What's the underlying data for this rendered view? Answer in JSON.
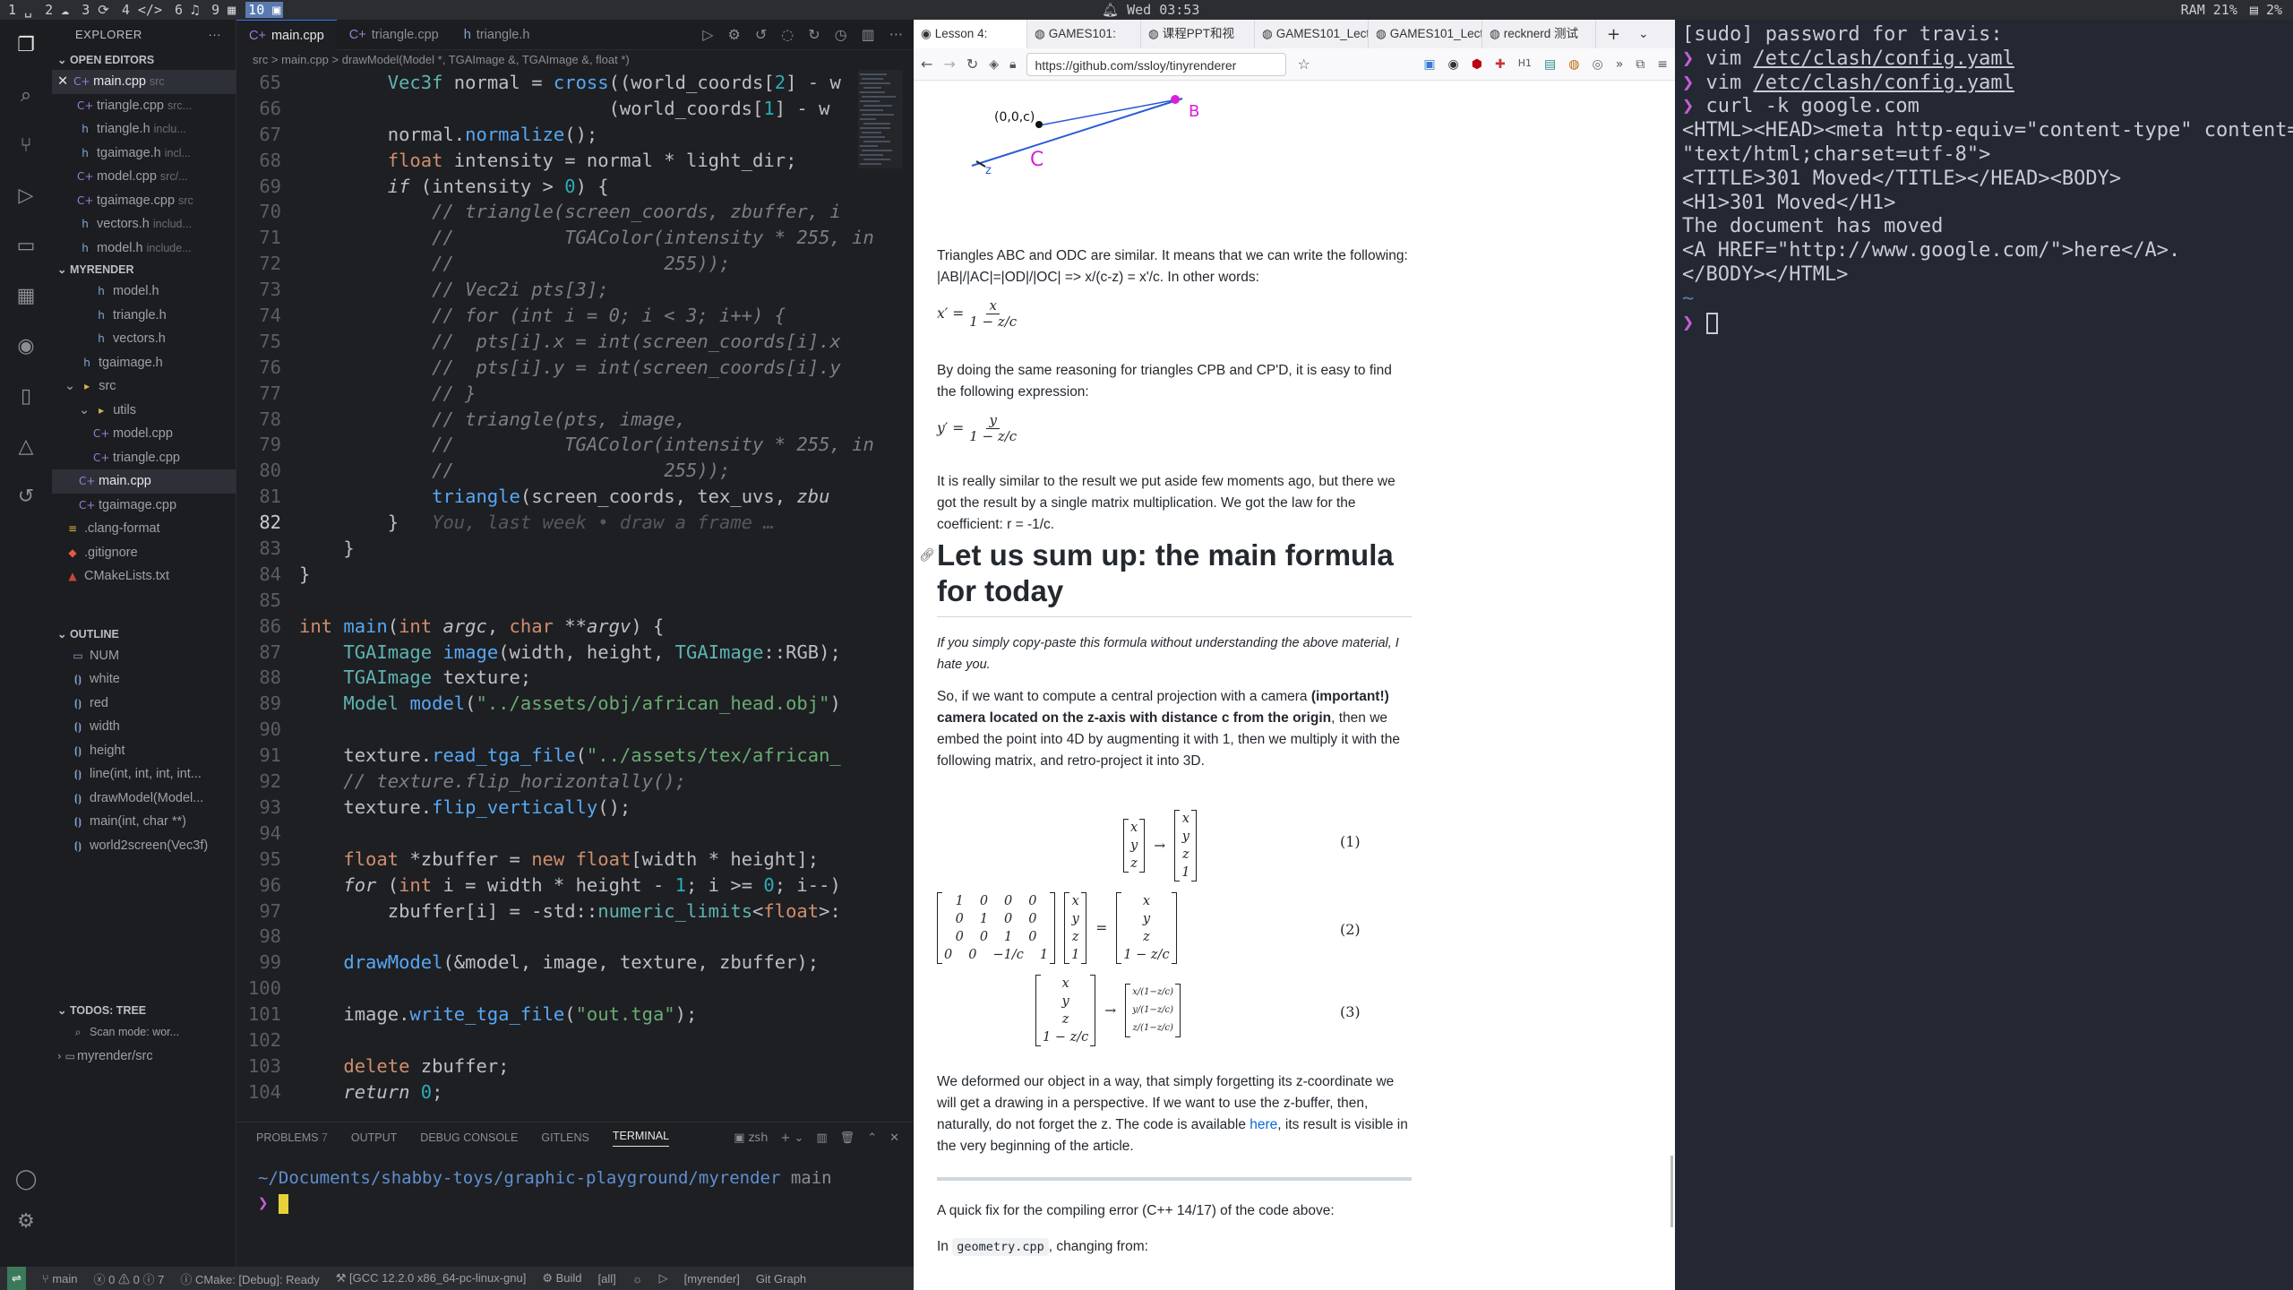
{
  "topbar": {
    "workspaces": [
      "1 ␣",
      "2 ☁",
      "3 ⟳",
      "4 </>",
      "6 ♫",
      "9 ▦",
      "10 ▣"
    ],
    "clock": "Wed 03:53",
    "ram": "RAM 21%",
    "cpu": "2%"
  },
  "vscode": {
    "explorer_title": "EXPLORER",
    "open_editors_title": "OPEN EDITORS",
    "open_editors": [
      {
        "name": "main.cpp",
        "hint": "src",
        "icon": "cpp-icon",
        "selected": true,
        "close": "✕"
      },
      {
        "name": "triangle.cpp",
        "hint": "src...",
        "icon": "cpp-icon"
      },
      {
        "name": "triangle.h",
        "hint": "inclu...",
        "icon": "h-icon"
      },
      {
        "name": "tgaimage.h",
        "hint": "incl...",
        "icon": "h-icon"
      },
      {
        "name": "model.cpp",
        "hint": "src/...",
        "icon": "cpp-icon"
      },
      {
        "name": "tgaimage.cpp",
        "hint": "src",
        "icon": "cpp-icon"
      },
      {
        "name": "vectors.h",
        "hint": "includ...",
        "icon": "h-icon"
      },
      {
        "name": "model.h",
        "hint": "include...",
        "icon": "h-icon"
      }
    ],
    "project_title": "MYRENDER",
    "tree": [
      {
        "name": "model.h",
        "indent": 2,
        "icon": "h-icon"
      },
      {
        "name": "triangle.h",
        "indent": 2,
        "icon": "h-icon"
      },
      {
        "name": "vectors.h",
        "indent": 2,
        "icon": "h-icon"
      },
      {
        "name": "tgaimage.h",
        "indent": 1,
        "icon": "h-icon"
      },
      {
        "name": "src",
        "indent": 0,
        "icon": "folder-icon"
      },
      {
        "name": "utils",
        "indent": 1,
        "icon": "folder-icon"
      },
      {
        "name": "model.cpp",
        "indent": 2,
        "icon": "cpp-icon"
      },
      {
        "name": "triangle.cpp",
        "indent": 2,
        "icon": "cpp-icon"
      },
      {
        "name": "main.cpp",
        "indent": 1,
        "icon": "cpp-icon",
        "selected": true
      },
      {
        "name": "tgaimage.cpp",
        "indent": 1,
        "icon": "cpp-icon"
      },
      {
        "name": ".clang-format",
        "indent": 0,
        "icon": "format-icon"
      },
      {
        "name": ".gitignore",
        "indent": 0,
        "icon": "git-icon"
      },
      {
        "name": "CMakeLists.txt",
        "indent": 0,
        "icon": "cmake-icon"
      }
    ],
    "outline_title": "OUTLINE",
    "outline": [
      "NUM",
      "white",
      "red",
      "width",
      "height",
      "line(int, int, int, int...",
      "drawModel(Model...",
      "main(int, char **)",
      "world2screen(Vec3f)"
    ],
    "todos_title": "TODOS: TREE",
    "todos": [
      "Scan mode: wor...",
      "myrender/src"
    ],
    "tabs": [
      {
        "label": "main.cpp",
        "active": true
      },
      {
        "label": "triangle.cpp"
      },
      {
        "label": "triangle.h"
      }
    ],
    "breadcrumb": "src > main.cpp > drawModel(Model *, TGAImage &, TGAImage &, float *)",
    "code_lines": [
      {
        "n": "65",
        "html": "        <span class='t'>Vec3f</span> normal = <span class='f'>cross</span>((world_coords[<span class='n'>2</span>] - w"
      },
      {
        "n": "66",
        "html": "                            (world_coords[<span class='n'>1</span>] - w"
      },
      {
        "n": "67",
        "html": "        normal.<span class='f'>normalize</span>();"
      },
      {
        "n": "68",
        "html": "        <span class='k'>float</span> intensity = normal * light_dir;"
      },
      {
        "n": "69",
        "html": "        <span class='k i'>if</span> (intensity &gt; <span class='n'>0</span>) {"
      },
      {
        "n": "70",
        "html": "            <span class='c'>// triangle(screen_coords, zbuffer, i</span>"
      },
      {
        "n": "71",
        "html": "            <span class='c'>//          TGAColor(intensity * 255, in</span>"
      },
      {
        "n": "72",
        "html": "            <span class='c'>//                   255));</span>"
      },
      {
        "n": "73",
        "html": "            <span class='c'>// Vec2i pts[3];</span>"
      },
      {
        "n": "74",
        "html": "            <span class='c'>// for (int i = 0; i &lt; 3; i++) {</span>"
      },
      {
        "n": "75",
        "html": "            <span class='c'>//  pts[i].x = int(screen_coords[i].x</span>"
      },
      {
        "n": "76",
        "html": "            <span class='c'>//  pts[i].y = int(screen_coords[i].y</span>"
      },
      {
        "n": "77",
        "html": "            <span class='c'>// }</span>"
      },
      {
        "n": "78",
        "html": "            <span class='c'>// triangle(pts, image,</span>"
      },
      {
        "n": "79",
        "html": "            <span class='c'>//          TGAColor(intensity * 255, in</span>"
      },
      {
        "n": "80",
        "html": "            <span class='c'>//                   255));</span>"
      },
      {
        "n": "81",
        "html": "            <span class='f'>triangle</span>(screen_coords, tex_uvs, <span class='i'>zbu</span>"
      },
      {
        "n": "82",
        "html": "        }   <span class='ghost'>You, last week • draw a frame …</span>",
        "current": true
      },
      {
        "n": "83",
        "html": "    }"
      },
      {
        "n": "84",
        "html": "}"
      },
      {
        "n": "85",
        "html": ""
      },
      {
        "n": "86",
        "html": "<span class='k'>int</span> <span class='f'>main</span>(<span class='k'>int</span> <span class='i'>argc</span>, <span class='k'>char</span> **<span class='i'>argv</span>) {"
      },
      {
        "n": "87",
        "html": "    <span class='t'>TGAImage</span> <span class='f'>image</span>(width, height, <span class='t'>TGAImage</span>::RGB);"
      },
      {
        "n": "88",
        "html": "    <span class='t'>TGAImage</span> texture;"
      },
      {
        "n": "89",
        "html": "    <span class='t'>Model</span> <span class='f'>model</span>(<span class='s'>\"../assets/obj/african_head.obj\"</span>)"
      },
      {
        "n": "90",
        "html": ""
      },
      {
        "n": "91",
        "html": "    texture.<span class='f'>read_tga_file</span>(<span class='s'>\"../assets/tex/african_</span>"
      },
      {
        "n": "92",
        "html": "    <span class='c'>// texture.flip_horizontally();</span>"
      },
      {
        "n": "93",
        "html": "    texture.<span class='f'>flip_vertically</span>();"
      },
      {
        "n": "94",
        "html": ""
      },
      {
        "n": "95",
        "html": "    <span class='k'>float</span> *zbuffer = <span class='k'>new</span> <span class='k'>float</span>[width * height];"
      },
      {
        "n": "96",
        "html": "    <span class='k i'>for</span> (<span class='k'>int</span> i = width * height - <span class='n'>1</span>; i &gt;= <span class='n'>0</span>; i--)"
      },
      {
        "n": "97",
        "html": "        zbuffer[i] = -std::<span class='t'>numeric_limits</span>&lt;<span class='k'>float</span>&gt;:"
      },
      {
        "n": "98",
        "html": ""
      },
      {
        "n": "99",
        "html": "    <span class='f'>drawModel</span>(&amp;model, image, texture, zbuffer);"
      },
      {
        "n": "100",
        "html": ""
      },
      {
        "n": "101",
        "html": "    image.<span class='f'>write_tga_file</span>(<span class='s'>\"out.tga\"</span>);"
      },
      {
        "n": "102",
        "html": ""
      },
      {
        "n": "103",
        "html": "    <span class='k'>delete</span> zbuffer;"
      },
      {
        "n": "104",
        "html": "    <span class='k i'>return</span> <span class='n'>0</span>;"
      }
    ],
    "panel_tabs": [
      "PROBLEMS",
      "OUTPUT",
      "DEBUG CONSOLE",
      "GITLENS",
      "TERMINAL"
    ],
    "problems_count": "7",
    "terminal_shell": "zsh",
    "terminal_path": "~/Documents/shabby-toys/graphic-playground/myrender",
    "terminal_branch": "main",
    "prompt": "❯",
    "status": {
      "branch": "main",
      "errors": "0",
      "warnings": "0",
      "infos": "7",
      "cmake": "CMake: [Debug]: Ready",
      "kit": "[GCC 12.2.0 x86_64-pc-linux-gnu]",
      "build": "Build",
      "target": "[all]",
      "project": "[myrender]",
      "gitgraph": "Git Graph"
    }
  },
  "browser": {
    "tabs": [
      {
        "label": "Lesson 4: ",
        "active": true,
        "icon": "github-icon"
      },
      {
        "label": "GAMES101: "
      },
      {
        "label": "课程PPT和视"
      },
      {
        "label": "GAMES101_Lect"
      },
      {
        "label": "GAMES101_Lect"
      },
      {
        "label": "recknerd 测试"
      }
    ],
    "url": "https://github.com/ssloy/tinyrenderer",
    "para1": "Triangles ABC and ODC are similar. It means that we can write the following: |AB|/|AC|=|OD|/|OC| => x/(c-z) = x'/c. In other words:",
    "eq_x_lhs": "x′ =",
    "eq_x_num": "x",
    "eq_den": "1 − z/c",
    "para2": "By doing the same reasoning for triangles CPB and CP'D, it is easy to find the following expression:",
    "eq_y_lhs": "y′ =",
    "eq_y_num": "y",
    "para3": "It is really similar to the result we put aside few moments ago, but there we got the result by a single matrix multiplication. We got the law for the coefficient: r = -1/c.",
    "heading": "Let us sum up: the main formula for today",
    "quote": "If you simply copy-paste this formula without understanding the above material, I hate you.",
    "para4_a": "So, if we want to compute a central projection with a camera ",
    "para4_b": "(important!) camera located on the z-axis with distance c from the origin",
    "para4_c": ", then we embed the point into 4D by augmenting it with 1, then we multiply it with the following matrix, and retro-project it into 3D.",
    "eq_numbers": [
      "(1)",
      "(2)",
      "(3)"
    ],
    "para5_a": "We deformed our object in a way, that simply forgetting its z-coordinate we will get a drawing in a perspective. If we want to use the z-buffer, then, naturally, do not forget the z. The code is available ",
    "para5_link": "here",
    "para5_b": ", its result is visible in the very beginning of the article.",
    "para6": "A quick fix for the compiling error (C++ 14/17) of the code above:",
    "para7_a": "In ",
    "para7_code": "geometry.cpp",
    "para7_b": ", changing from:",
    "diagram_labels": [
      "(0,0,c)",
      "B",
      "C",
      "z"
    ]
  },
  "right_terminal": {
    "lines": [
      {
        "text": "[sudo] password for travis:"
      },
      {
        "prompt": "❯ ",
        "cmd": "vim ",
        "arg": "/etc/clash/config.yaml"
      },
      {
        "prompt": "❯ ",
        "cmd": "vim ",
        "arg": "/etc/clash/config.yaml"
      },
      {
        "prompt": "❯ ",
        "cmd": "curl -k google.com"
      },
      {
        "text": "<HTML><HEAD><meta http-equiv=\"content-type\" content="
      },
      {
        "text": "\"text/html;charset=utf-8\">"
      },
      {
        "text": "<TITLE>301 Moved</TITLE></HEAD><BODY>"
      },
      {
        "text": "<H1>301 Moved</H1>"
      },
      {
        "text": "The document has moved"
      },
      {
        "text": "<A HREF=\"http://www.google.com/\">here</A>."
      },
      {
        "text": "</BODY></HTML>"
      },
      {
        "dim": "~"
      },
      {
        "prompt": "❯ ",
        "cursor": true
      }
    ]
  }
}
